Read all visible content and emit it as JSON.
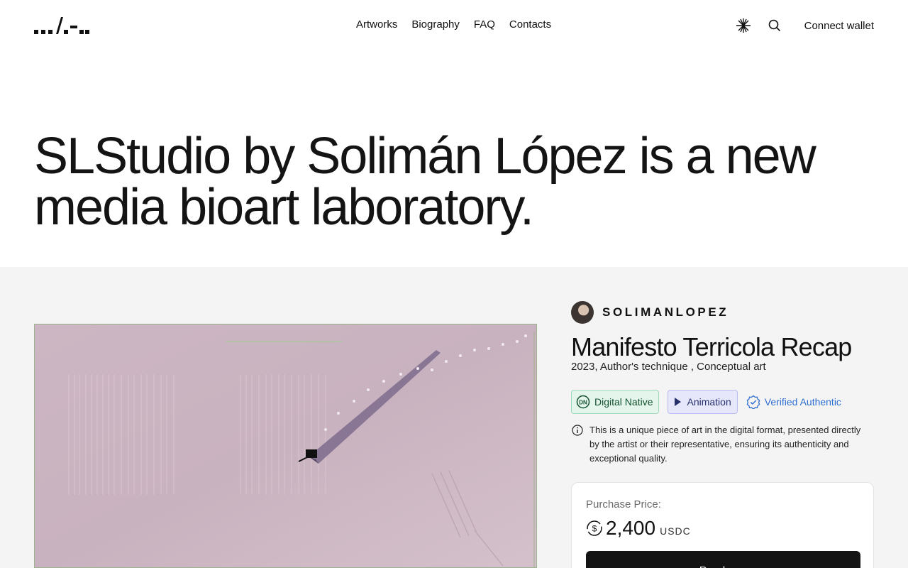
{
  "header": {
    "logo_icon": "studio-logo",
    "nav": [
      "Artworks",
      "Biography",
      "FAQ",
      "Contacts"
    ],
    "theme_icon": "sparkle-icon",
    "search_icon": "search-icon",
    "connect_label": "Connect wallet"
  },
  "hero": {
    "title": "SLStudio by Solimán López is a new media bioart laboratory."
  },
  "artwork": {
    "artist": "SOLIMANLOPEZ",
    "title": "Manifesto Terricola Recap",
    "meta": "2023, Author's technique , Conceptual art",
    "badges": {
      "digital_native": "Digital Native",
      "animation": "Animation",
      "verified": "Verified Authentic"
    },
    "info": "This is a unique piece of art in the digital format, presented directly by the artist or their representative, ensuring its authenticity and exceptional quality."
  },
  "purchase": {
    "label": "Purchase Price:",
    "value": "2,400",
    "currency": "USDC",
    "button": "Purchase"
  },
  "colors": {
    "page_bg": "#ffffff",
    "section_bg": "#f4f4f4",
    "button_bg": "#141414",
    "digital_native_bg": "#e4f5ec",
    "animation_bg": "#e6e7fb",
    "verified_text": "#2f6fd1"
  }
}
